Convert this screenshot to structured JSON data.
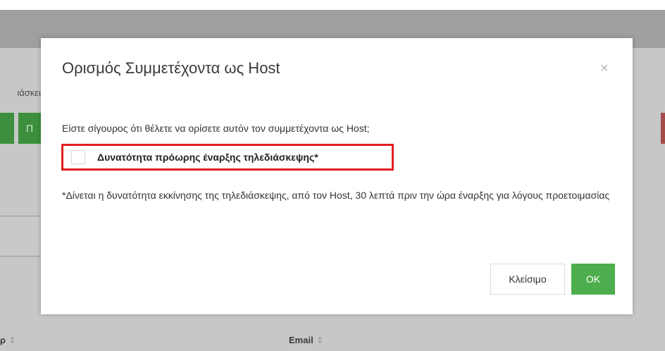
{
  "background": {
    "field_label_fragment": "ιάσκει",
    "green_button_fragment": "Π",
    "column_left_fragment": "ρ",
    "column_email_label": "Email"
  },
  "modal": {
    "title": "Ορισμός Συμμετέχοντα ως Host",
    "close_symbol": "×",
    "confirm_text": "Είστε σίγουρος ότι θέλετε να ορίσετε αυτόν τον συμμετέχοντα ως Host;",
    "checkbox_label": "Δυνατότητα πρόωρης έναρξης τηλεδιάσκεψης*",
    "note_text": "*Δίνεται η δυνατότητα εκκίνησης της τηλεδιάσκεψης, από τον Host, 30 λεπτά πριν την ώρα έναρξης για λόγους προετοιμασίας",
    "close_button_label": "Κλείσιμο",
    "ok_button_label": "OK"
  },
  "colors": {
    "ok_button": "#4cae4c",
    "highlight_border": "#e41f1f"
  },
  "icons": {
    "sort": "sort-icon",
    "close": "close-icon"
  }
}
